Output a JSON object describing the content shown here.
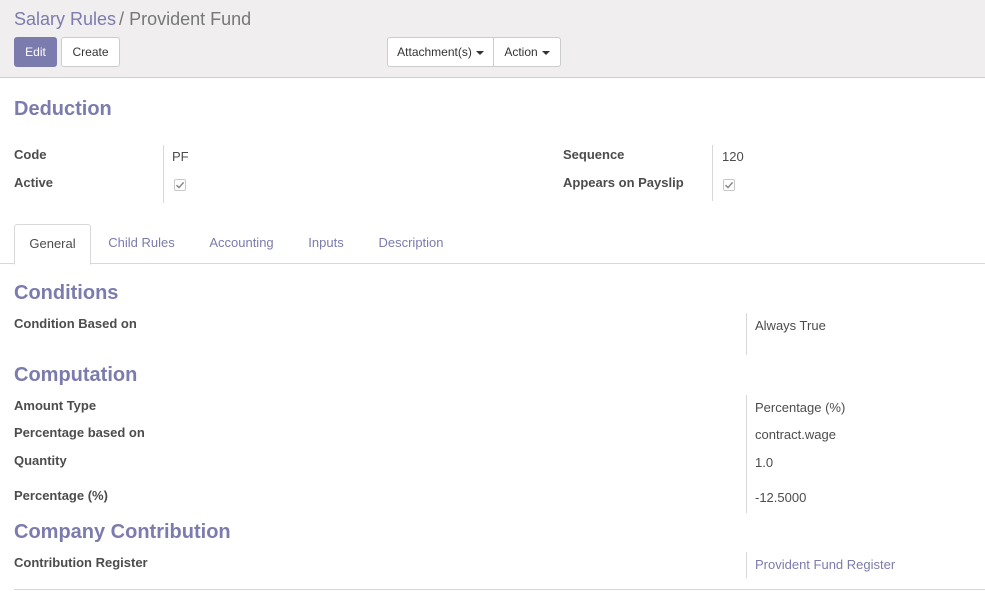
{
  "breadcrumb": {
    "parent": "Salary Rules",
    "separator": "/",
    "current": "Provident Fund"
  },
  "toolbar": {
    "edit_label": "Edit",
    "create_label": "Create",
    "attachments_label": "Attachment(s)",
    "action_label": "Action"
  },
  "form": {
    "category": "Deduction",
    "code_label": "Code",
    "code_value": "PF",
    "active_label": "Active",
    "active_checked": true,
    "sequence_label": "Sequence",
    "sequence_value": "120",
    "payslip_label": "Appears on Payslip",
    "payslip_checked": true
  },
  "tabs": [
    {
      "label": "General",
      "active": true
    },
    {
      "label": "Child Rules",
      "active": false
    },
    {
      "label": "Accounting",
      "active": false
    },
    {
      "label": "Inputs",
      "active": false
    },
    {
      "label": "Description",
      "active": false
    }
  ],
  "conditions": {
    "title": "Conditions",
    "condition_label": "Condition Based on",
    "condition_value": "Always True"
  },
  "computation": {
    "title": "Computation",
    "amount_type_label": "Amount Type",
    "amount_type_value": "Percentage (%)",
    "pct_based_label": "Percentage based on",
    "pct_based_value": "contract.wage",
    "quantity_label": "Quantity",
    "quantity_value": "1.0",
    "percentage_label": "Percentage (%)",
    "percentage_value": "-12.5000"
  },
  "company": {
    "title": "Company Contribution",
    "register_label": "Contribution Register",
    "register_value": "Provident Fund Register"
  },
  "colors": {
    "accent": "#7c7bad",
    "panel": "#f0eeee",
    "text": "#4c4c4c"
  }
}
